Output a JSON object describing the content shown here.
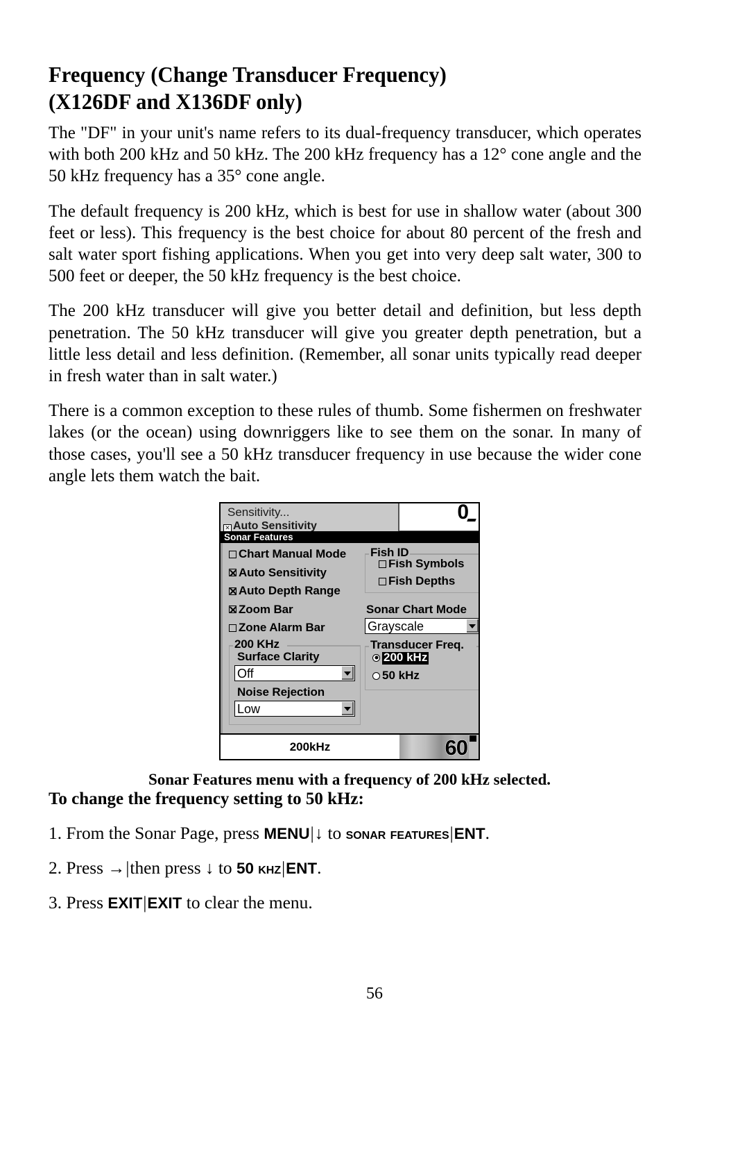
{
  "document": {
    "heading_line1": "Frequency (Change Transducer Frequency)",
    "heading_line2": "(X126DF and X136DF only)",
    "page_number": "56"
  },
  "paragraphs": [
    "The \"DF\" in your unit's name refers to its dual-frequency transducer, which operates with both 200 kHz and 50 kHz. The 200 kHz frequency has a 12° cone angle and the 50 kHz frequency has a 35° cone angle.",
    "The default frequency is 200 kHz, which is best for use in shallow water (about 300 feet or less). This frequency is the best choice for about 80 percent of the fresh and salt water sport fishing applications. When you get into very deep salt water, 300 to 500 feet or deeper, the 50 kHz frequency is the best choice.",
    "The 200 kHz transducer will give you better detail and definition, but less depth penetration. The 50 kHz transducer will give you greater depth penetration, but a little less detail and less definition. (Remember, all sonar units typically read deeper in fresh water than in salt water.)",
    "There is a common exception to these rules of thumb. Some fishermen on freshwater lakes (or the ocean) using downriggers like to see them on the sonar. In many of those cases, you'll see a 50 kHz transducer frequency in use because the wider cone angle lets them watch the bait."
  ],
  "figure": {
    "caption": "Sonar Features menu with a frequency of 200 kHz selected.",
    "background_menu": {
      "item1": "Sensitivity...",
      "item2": "Auto Sensitivity",
      "depth_zero": "0"
    },
    "titlebar": "Sonar Features",
    "checkboxes": [
      {
        "label": "Chart Manual Mode",
        "checked": false
      },
      {
        "label": "Auto Sensitivity",
        "checked": true
      },
      {
        "label": "Auto Depth Range",
        "checked": true
      },
      {
        "label": "Zoom Bar",
        "checked": true
      },
      {
        "label": "Zone Alarm Bar",
        "checked": false
      }
    ],
    "khz_group": {
      "title": "200 KHz",
      "surface_clarity_label": "Surface Clarity",
      "surface_clarity_value": "Off",
      "noise_rejection_label": "Noise Rejection",
      "noise_rejection_value": "Low"
    },
    "fish_id_group": {
      "title": "Fish ID",
      "items": [
        {
          "label": "Fish Symbols",
          "checked": false
        },
        {
          "label": "Fish Depths",
          "checked": false
        }
      ]
    },
    "sonar_chart_mode": {
      "label": "Sonar Chart Mode",
      "value": "Grayscale"
    },
    "transducer_freq": {
      "title": "Transducer Freq.",
      "options": [
        {
          "label": "200 kHz",
          "selected": true
        },
        {
          "label": "50 kHz",
          "selected": false
        }
      ]
    },
    "statusbar": {
      "frequency": "200kHz",
      "depth": "60"
    }
  },
  "procedure": {
    "heading": "To change the frequency setting to 50 kHz:",
    "steps": [
      {
        "number": "1.",
        "text_before": "From the Sonar Page, press",
        "key1": "MENU",
        "sep": "|",
        "arrow": "↓",
        "text_mid": "to",
        "key2": "Sonar Features",
        "key3": "ENT",
        "end": "."
      },
      {
        "number": "2.",
        "text_before": "Press",
        "arrow1": "→",
        "sep": "|",
        "text_mid1": "then press",
        "arrow2": "↓",
        "text_mid2": "to",
        "key1": "50 kHz",
        "key2": "ENT",
        "end": "."
      },
      {
        "number": "3.",
        "text_before": "Press",
        "key1": "EXIT",
        "sep": "|",
        "key2": "EXIT",
        "text_after": "to clear the menu."
      }
    ]
  }
}
